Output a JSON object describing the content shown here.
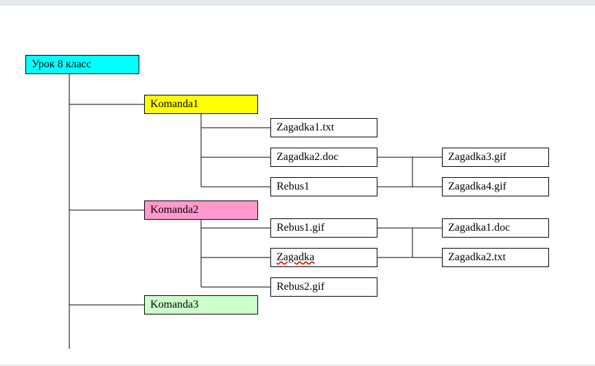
{
  "root": {
    "label": "Урок 8 класс"
  },
  "komanda1": {
    "label": "Komanda1",
    "children": {
      "zagadka1": "Zagadka1.txt",
      "zagadka2": "Zagadka2.doc",
      "rebus1": "Rebus1",
      "rebus1_children": {
        "zagadka3": "Zagadka3.gif",
        "zagadka4": "Zagadka4.gif"
      }
    }
  },
  "komanda2": {
    "label": "Komanda2",
    "children": {
      "rebus1gif": "Rebus1.gif",
      "zagadka": "Zagadka",
      "rebus2gif": "Rebus2.gif",
      "zagadka_children": {
        "zagadka1doc": "Zagadka1.doc",
        "zagadka2txt": "Zagadka2.txt"
      }
    }
  },
  "komanda3": {
    "label": "Komanda3"
  },
  "colors": {
    "root": "#00ffff",
    "yellow": "#ffff00",
    "pink": "#ff99cc",
    "green": "#ccffcc"
  }
}
